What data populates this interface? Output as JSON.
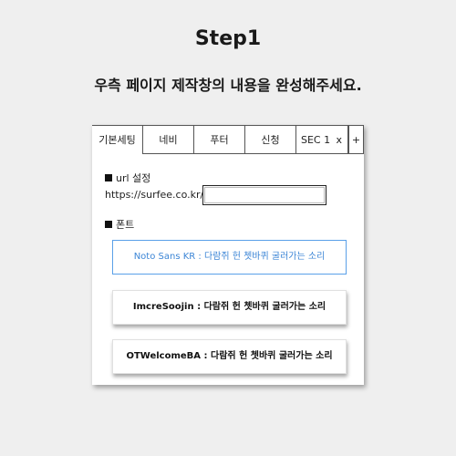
{
  "header": {
    "step_title": "Step1",
    "instruction": "우측 페이지 제작창의 내용을 완성해주세요."
  },
  "tabs": [
    {
      "label": "기본세팅"
    },
    {
      "label": "네비"
    },
    {
      "label": "푸터"
    },
    {
      "label": "신청"
    },
    {
      "label": "SEC 1",
      "close": "x"
    },
    {
      "label": "+"
    }
  ],
  "url_section": {
    "label": "url 설정",
    "prefix": "https://surfee.co.kr/",
    "value": ""
  },
  "font_section": {
    "label": "폰트",
    "options": [
      {
        "label": "Noto Sans KR : 다람쥐 헌 쳇바퀴 굴러가는 소리",
        "selected": true
      },
      {
        "label": "ImcreSoojin : 다람쥐 헌 쳇바퀴 굴러가는 소리",
        "selected": false
      },
      {
        "label": "OTWelcomeBA : 다람쥐 헌 쳇바퀴 굴러가는 소리",
        "selected": false
      }
    ]
  },
  "colors": {
    "background": "#efefef",
    "panel": "#ffffff",
    "selected_border": "#5aa0e8",
    "selected_text": "#3d86d6"
  }
}
